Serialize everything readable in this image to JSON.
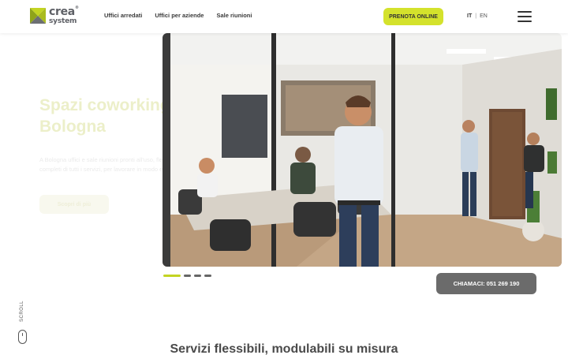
{
  "brand": {
    "line1": "crea",
    "line2": "system",
    "reg": "®",
    "accent": "#d4e22c"
  },
  "nav": {
    "items": [
      "Uffici arredati",
      "Uffici per aziende",
      "Sale riunioni"
    ]
  },
  "header": {
    "book_label": "PRENOTA ONLINE",
    "lang_active": "IT",
    "lang_sep": "|",
    "lang_other": "EN"
  },
  "hero": {
    "title": "Spazi coworking a Bologna",
    "description": "A Bologna uffici e sale riunioni pronti all'uso, flessibili e completi di tutti i servizi, per lavorare in modo efficiente.",
    "cta_label": "Scopri di più",
    "slides_total": 4,
    "slide_active": 1
  },
  "contact": {
    "call_label": "CHIAMACI: 051 269 190"
  },
  "scroll": {
    "label": "SCROLL"
  },
  "section": {
    "title": "Servizi flessibili, modulabili su misura"
  }
}
